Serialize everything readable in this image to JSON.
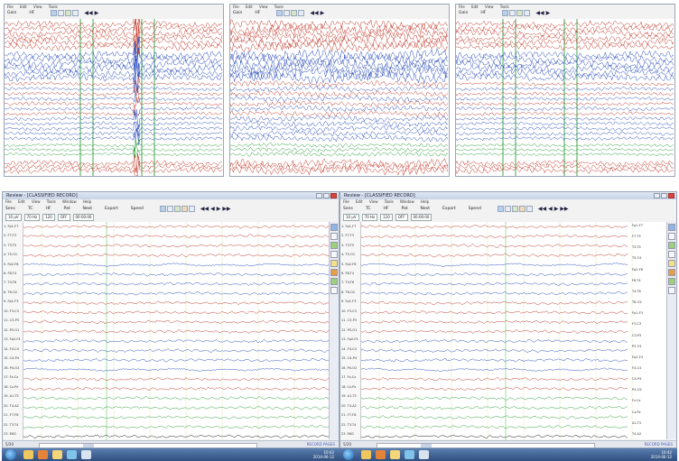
{
  "top_panels": [
    {
      "menu": [
        "File",
        "Edit",
        "View",
        "Tools",
        "Window",
        "Help"
      ],
      "toolbar_labels": [
        "Gain",
        "HF",
        "LF",
        "Notch",
        "Montage"
      ]
    },
    {
      "menu": [
        "File",
        "Edit",
        "View",
        "Tools",
        "Window",
        "Help"
      ],
      "toolbar_labels": [
        "Gain",
        "HF",
        "LF",
        "Notch",
        "Montage"
      ]
    },
    {
      "menu": [
        "File",
        "Edit",
        "View",
        "Tools",
        "Window",
        "Help"
      ],
      "toolbar_labels": [
        "Gain",
        "HF",
        "LF",
        "Notch",
        "Montage"
      ]
    }
  ],
  "bottom_left": {
    "title": "Review - [CLASSIFIED RECORD]",
    "menu": [
      "File",
      "Edit",
      "View",
      "Tools",
      "Window",
      "Help"
    ],
    "toolbar_labels": [
      "Sens",
      "TC",
      "HF",
      "Pat",
      "Next",
      "Export",
      "Speed"
    ],
    "fields": [
      "10 µV",
      "70 Hz",
      "120",
      "OFF"
    ],
    "time": "00:00:00",
    "channels": [
      "1. Fp1-F7",
      "2. F7-T3",
      "3. T3-T5",
      "4. T5-O1",
      "5. Fp2-F8",
      "6. F8-T4",
      "7. T4-T6",
      "8. T6-O2",
      "9. Fp1-F3",
      "10. F3-C3",
      "11. C3-P3",
      "12. P3-O1",
      "13. Fp2-F4",
      "14. F4-C4",
      "15. C4-P4",
      "16. P4-O2",
      "17. Fz-Cz",
      "18. Cz-Pz",
      "19. A1-T3",
      "20. T4-A2",
      "21. F7-F8",
      "22. T3-T4",
      "23. EKG"
    ],
    "status_left": "5/20",
    "status_right": "RECORD PAGES",
    "colors": {
      "red": "#c0392b",
      "blue": "#2b4dbb",
      "green": "#2e9e3a",
      "black": "#111111"
    }
  },
  "bottom_right": {
    "title": "Review - [CLASSIFIED RECORD]",
    "menu": [
      "File",
      "Edit",
      "View",
      "Tools",
      "Window",
      "Help"
    ],
    "toolbar_labels": [
      "Sens",
      "TC",
      "HF",
      "Pat",
      "Next",
      "Export",
      "Speed"
    ],
    "fields": [
      "10 µV",
      "70 Hz",
      "120",
      "OFF"
    ],
    "time": "00:00:00",
    "channels": [
      "1. Fp1-F7",
      "2. F7-T3",
      "3. T3-T5",
      "4. T5-O1",
      "5. Fp2-F8",
      "6. F8-T4",
      "7. T4-T6",
      "8. T6-O2",
      "9. Fp1-F3",
      "10. F3-C3",
      "11. C3-P3",
      "12. P3-O1",
      "13. Fp2-F4",
      "14. F4-C4",
      "15. C4-P4",
      "16. P4-O2",
      "17. Fz-Cz",
      "18. Cz-Pz",
      "19. A1-T3",
      "20. T4-A2",
      "21. F7-F8",
      "22. T3-T4",
      "23. EKG"
    ],
    "right_labels": [
      "Fp1-F7",
      "F7-T3",
      "T3-T5",
      "T5-O1",
      "Fp2-F8",
      "F8-T4",
      "T4-T6",
      "T6-O2",
      "Fp1-F3",
      "F3-C3",
      "C3-P3",
      "P3-O1",
      "Fp2-F4",
      "F4-C4",
      "C4-P4",
      "P4-O2",
      "Fz-Cz",
      "Cz-Pz",
      "A1-T3",
      "T4-A2"
    ],
    "status_left": "5/20",
    "status_right": "RECORD PAGES"
  },
  "taskbar": {
    "clock_time": "10:42",
    "clock_date": "2014-06-12"
  }
}
